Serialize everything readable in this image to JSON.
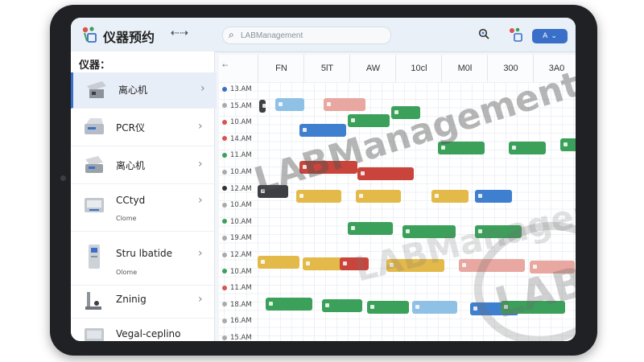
{
  "header": {
    "app_title": "仪器预约",
    "collapse_icon": "collapse-arrows-icon",
    "search_placeholder": "LABManagement",
    "user_badge": "A",
    "user_chevron": "⌄"
  },
  "sidebar": {
    "heading": "仪器：",
    "items": [
      {
        "name": "离心机",
        "sub": "",
        "active": true
      },
      {
        "name": "PCR仪",
        "sub": ""
      },
      {
        "name": "离心机",
        "sub": ""
      },
      {
        "name": "CCtyd",
        "sub": "Clome"
      },
      {
        "name": "Stru lbatide",
        "sub": "Olome"
      },
      {
        "name": "Zninig",
        "sub": ""
      },
      {
        "name": "Vegal-ceplino",
        "sub": ""
      }
    ]
  },
  "schedule": {
    "days": [
      "FN",
      "5lT",
      "AW",
      "10cl",
      "M0l",
      "300",
      "3A0"
    ],
    "times": [
      {
        "label": "13.AM",
        "color": "#3a6fc9"
      },
      {
        "label": "15.AM",
        "color": "#aaaaaa"
      },
      {
        "label": "10.AM",
        "color": "#d9534f"
      },
      {
        "label": "14.AM",
        "color": "#d9534f"
      },
      {
        "label": "11.AM",
        "color": "#3aa05a"
      },
      {
        "label": "10.AM",
        "color": "#aaaaaa"
      },
      {
        "label": "12.AM",
        "color": "#333333"
      },
      {
        "label": "10.AM",
        "color": "#aaaaaa"
      },
      {
        "label": "10.AM",
        "color": "#3aa05a"
      },
      {
        "label": "19.AM",
        "color": "#aaaaaa"
      },
      {
        "label": "12.AM",
        "color": "#aaaaaa"
      },
      {
        "label": "10.AM",
        "color": "#3aa05a"
      },
      {
        "label": "11.AM",
        "color": "#d9534f"
      },
      {
        "label": "18.AM",
        "color": "#aaaaaa"
      },
      {
        "label": "16.AM",
        "color": "#aaaaaa"
      },
      {
        "label": "15.AM",
        "color": "#aaaaaa"
      }
    ]
  },
  "colors": {
    "accent": "#3a6fc9",
    "green": "#3aa05a",
    "blue": "#3f7fcf",
    "red": "#c9453c",
    "pink": "#e8a7a0",
    "yellow": "#e3b94a",
    "lightblue": "#8fc1e6",
    "dark": "#3c3f44"
  },
  "watermark": {
    "line1": "LABManagement",
    "line2": "LABManagement",
    "stamp": "LABI"
  }
}
